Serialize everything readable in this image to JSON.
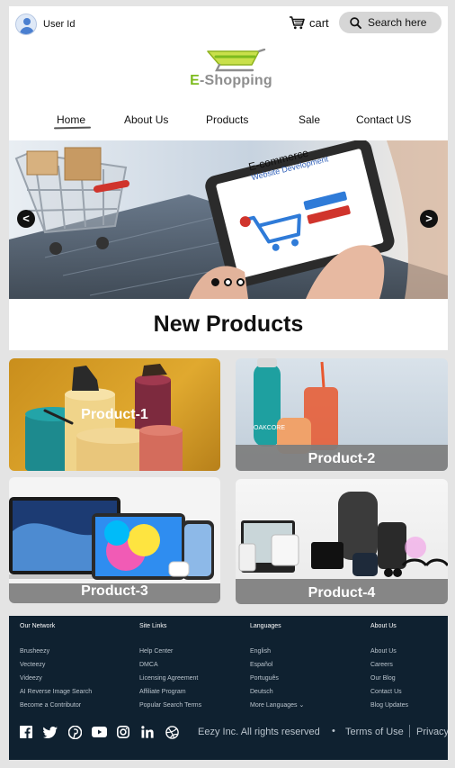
{
  "header": {
    "user_label": "User Id",
    "cart_label": "cart",
    "search_placeholder": "Search here"
  },
  "logo": {
    "e": "E",
    "rest": "-Shopping"
  },
  "nav": {
    "home": "Home",
    "about": "About Us",
    "products": "Products",
    "sale": "Sale",
    "contact": "Contact US"
  },
  "hero": {
    "tablet_line1": "E-commerce",
    "tablet_line2": "Website Development",
    "prev": "<",
    "next": ">",
    "slide_index": 1,
    "slide_count": 3
  },
  "section_title": "New Products",
  "products": [
    "Product-1",
    "Product-2",
    "Product-3",
    "Product-4"
  ],
  "product_brand": "OAKCORE",
  "footer": {
    "columns": [
      {
        "title": "Our Network",
        "links": [
          "Brusheezy",
          "Vecteezy",
          "Videezy",
          "AI Reverse Image Search",
          "Become a Contributor"
        ]
      },
      {
        "title": "Site Links",
        "links": [
          "Help Center",
          "DMCA",
          "Licensing Agreement",
          "Affiliate Program",
          "Popular Search Terms"
        ]
      },
      {
        "title": "Languages",
        "links": [
          "English",
          "Español",
          "Português",
          "Deutsch",
          "More Languages ⌄"
        ]
      },
      {
        "title": "About Us",
        "links": [
          "About Us",
          "Careers",
          "Our Blog",
          "Contact Us",
          "Blog Updates"
        ]
      }
    ],
    "copyright": "Eezy Inc. All rights reserved",
    "separator": "•",
    "terms": "Terms of Use",
    "privacy": "Privacy"
  },
  "colors": {
    "logo_green": "#7dbb1e",
    "logo_gray": "#8e8e8e",
    "footer_bg": "#0f2130",
    "hero_cart_red": "#d0342c"
  }
}
